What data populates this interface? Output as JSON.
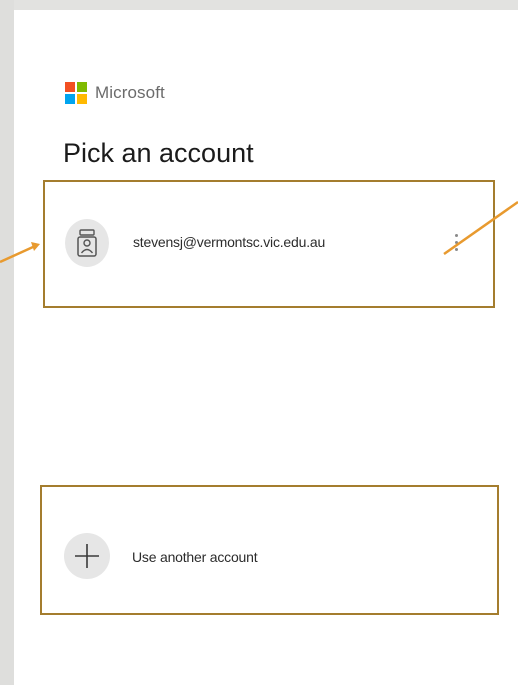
{
  "brand": {
    "name": "Microsoft",
    "logo_colors": [
      "#f25022",
      "#7fba00",
      "#00a4ef",
      "#ffb900"
    ]
  },
  "page": {
    "title": "Pick an account"
  },
  "accounts": [
    {
      "email": "stevensj@vermontsc.vic.edu.au",
      "avatar_icon": "id-badge-icon",
      "more_icon": "more-options-icon"
    }
  ],
  "another_account": {
    "label": "Use another account",
    "icon": "plus-icon"
  },
  "annotations": {
    "highlight_color": "#a47d2e",
    "arrow_color": "#e89a2f"
  }
}
